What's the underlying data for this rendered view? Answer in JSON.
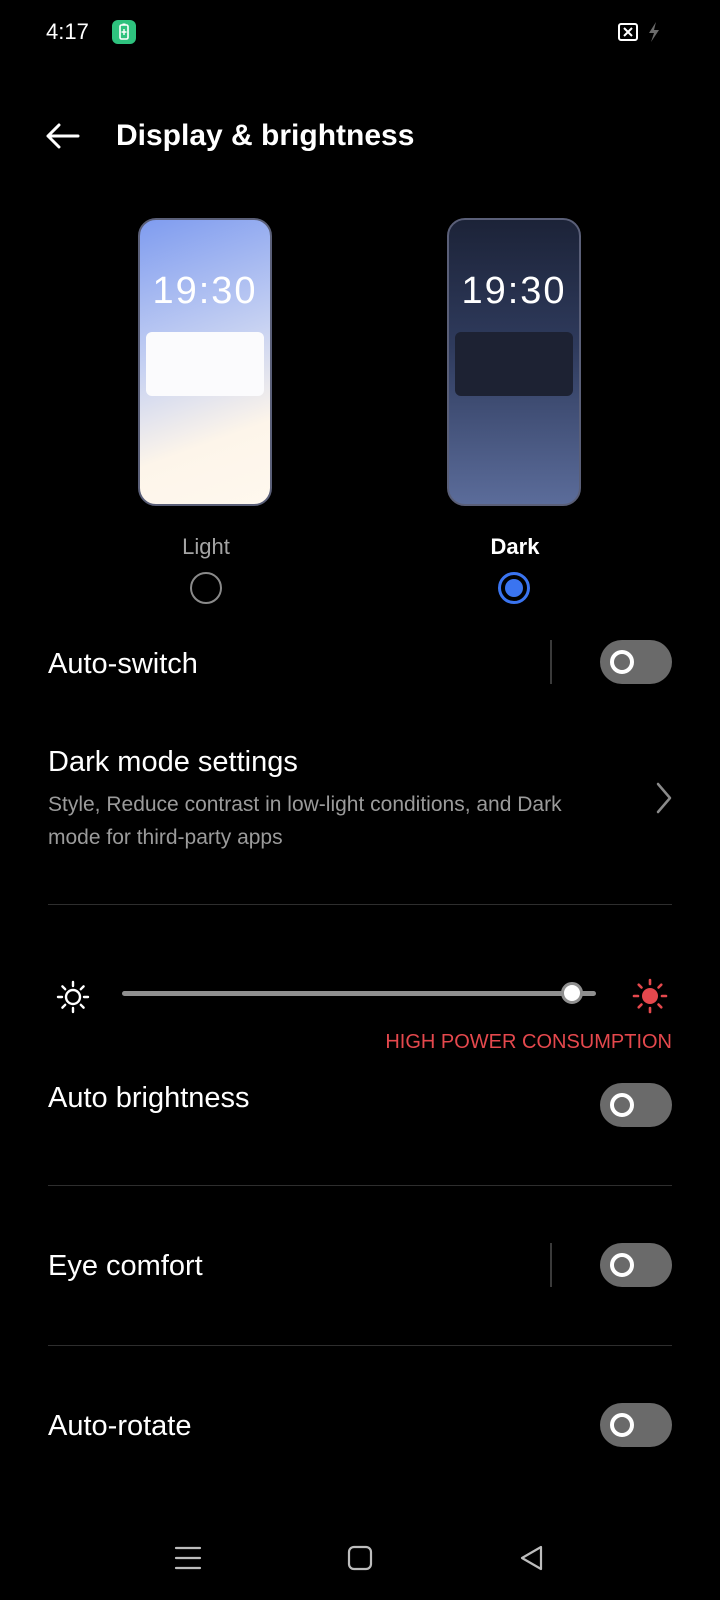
{
  "status_bar": {
    "time": "4:17",
    "battery_icon": "battery-saver-icon",
    "battery_color": "#2ec27e",
    "right_icons": [
      "close-box-icon",
      "charging-bolt-icon"
    ]
  },
  "header": {
    "title": "Display & brightness",
    "back_icon": "back-arrow-icon"
  },
  "theme": {
    "light": {
      "preview_time": "19:30",
      "label": "Light",
      "selected": false
    },
    "dark": {
      "preview_time": "19:30",
      "label": "Dark",
      "selected": true
    },
    "accent_color": "#3a74f0"
  },
  "auto_switch": {
    "label": "Auto-switch",
    "enabled": false
  },
  "dark_mode_settings": {
    "title": "Dark mode settings",
    "subtitle": "Style, Reduce contrast in low-light conditions, and Dark mode for third-party apps"
  },
  "brightness": {
    "level": 0.95,
    "warning": "HIGH POWER CONSUMPTION",
    "warning_color": "#e5484d"
  },
  "auto_brightness": {
    "label": "Auto brightness",
    "enabled": false
  },
  "eye_comfort": {
    "label": "Eye comfort",
    "enabled": false
  },
  "auto_rotate": {
    "label": "Auto-rotate",
    "enabled": false
  },
  "nav_bar": {
    "icons": [
      "menu-icon",
      "home-icon",
      "back-triangle-icon"
    ]
  }
}
